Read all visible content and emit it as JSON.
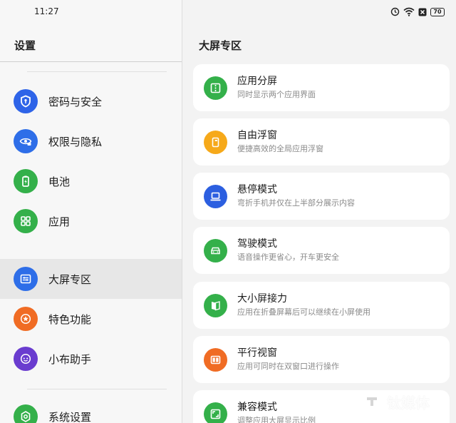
{
  "status_bar": {
    "time": "11:27",
    "battery": "70",
    "icons": [
      "alarm-icon",
      "wifi-icon",
      "sim-off-icon",
      "battery-icon"
    ]
  },
  "left_pane": {
    "title": "设置",
    "items": [
      {
        "label": "密码与安全",
        "icon": "shield-icon",
        "color": "#2e64e8",
        "active": false
      },
      {
        "label": "权限与隐私",
        "icon": "eye-lock-icon",
        "color": "#2e6ee8",
        "active": false
      },
      {
        "label": "电池",
        "icon": "battery-charging-icon",
        "color": "#34b04a",
        "active": false
      },
      {
        "label": "应用",
        "icon": "apps-grid-icon",
        "color": "#34b04a",
        "active": false
      },
      {
        "label": "大屏专区",
        "icon": "sliders-icon",
        "color": "#2e6ee8",
        "active": true
      },
      {
        "label": "特色功能",
        "icon": "star-icon",
        "color": "#f06c24",
        "active": false
      },
      {
        "label": "小布助手",
        "icon": "assistant-icon",
        "color": "#6a3ccf",
        "active": false
      },
      {
        "label": "系统设置",
        "icon": "system-gear-icon",
        "color": "#34b04a",
        "active": false
      }
    ]
  },
  "right_pane": {
    "title": "大屏专区",
    "cards": [
      {
        "title": "应用分屏",
        "subtitle": "同时显示两个应用界面",
        "icon": "split-screen-icon",
        "color": "#34b04a"
      },
      {
        "title": "自由浮窗",
        "subtitle": "便捷高效的全局应用浮窗",
        "icon": "floating-window-icon",
        "color": "#f6a91a"
      },
      {
        "title": "悬停模式",
        "subtitle": "弯折手机并仅在上半部分展示内容",
        "icon": "laptop-icon",
        "color": "#2c5fe0"
      },
      {
        "title": "驾驶模式",
        "subtitle": "语音操作更省心，开车更安全",
        "icon": "car-icon",
        "color": "#34b04a"
      },
      {
        "title": "大小屏接力",
        "subtitle": "应用在折叠屏幕后可以继续在小屏使用",
        "icon": "fold-book-icon",
        "color": "#34b04a"
      },
      {
        "title": "平行视窗",
        "subtitle": "应用可同时在双窗口进行操作",
        "icon": "parallel-window-icon",
        "color": "#f06c24"
      },
      {
        "title": "兼容模式",
        "subtitle": "调整应用大屏显示比例",
        "icon": "aspect-ratio-icon",
        "color": "#34b04a"
      }
    ]
  },
  "watermark": {
    "text": "钛媒体"
  }
}
